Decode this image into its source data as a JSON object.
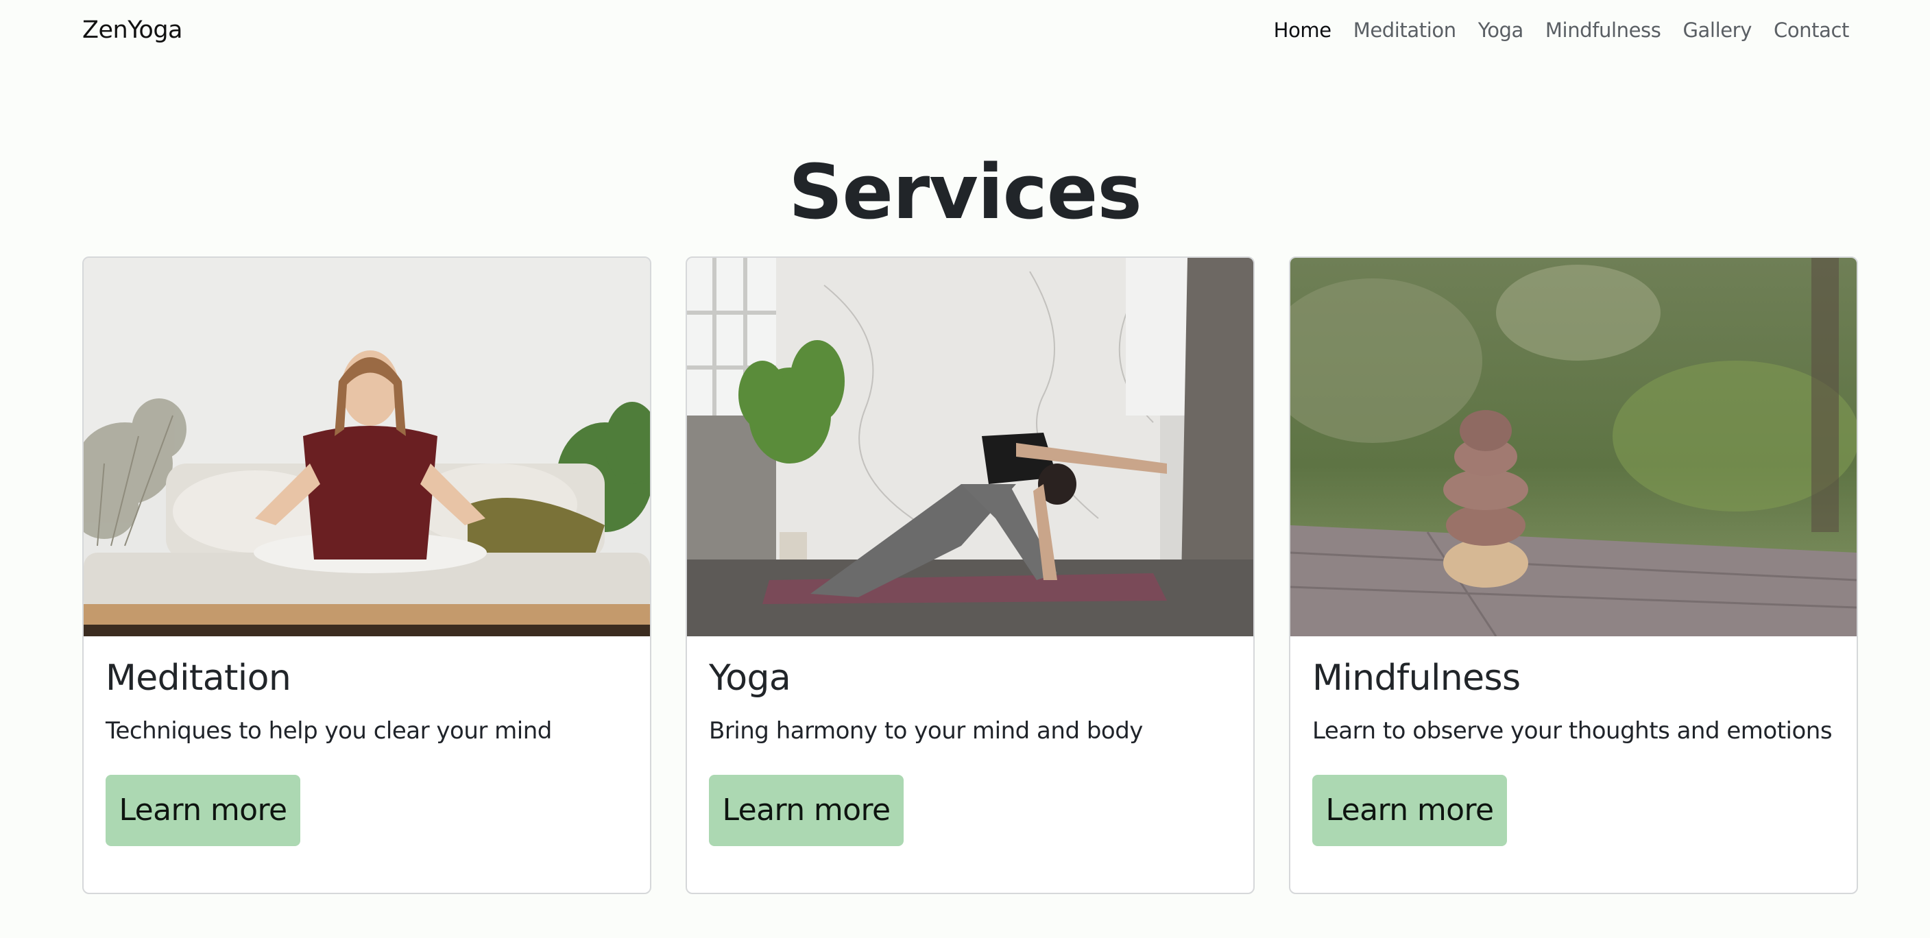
{
  "navbar": {
    "brand": "ZenYoga",
    "links": [
      {
        "label": "Home",
        "active": true
      },
      {
        "label": "Meditation",
        "active": false
      },
      {
        "label": "Yoga",
        "active": false
      },
      {
        "label": "Mindfulness",
        "active": false
      },
      {
        "label": "Gallery",
        "active": false
      },
      {
        "label": "Contact",
        "active": false
      }
    ]
  },
  "services": {
    "title": "Services",
    "cards": [
      {
        "image": "woman-meditating-on-sofa-photo",
        "title": "Meditation",
        "text": "Techniques to help you clear your mind",
        "button": "Learn more"
      },
      {
        "image": "woman-yoga-stretch-photo",
        "title": "Yoga",
        "text": "Bring harmony to your mind and body",
        "button": "Learn more"
      },
      {
        "image": "stacked-stones-photo",
        "title": "Mindfulness",
        "text": "Learn to observe your thoughts and emotions",
        "button": "Learn more"
      }
    ]
  },
  "colors": {
    "page_background": "#fbfdfa",
    "button_background": "#acd8b2",
    "card_border": "#d6d8da",
    "heading": "#212529"
  }
}
